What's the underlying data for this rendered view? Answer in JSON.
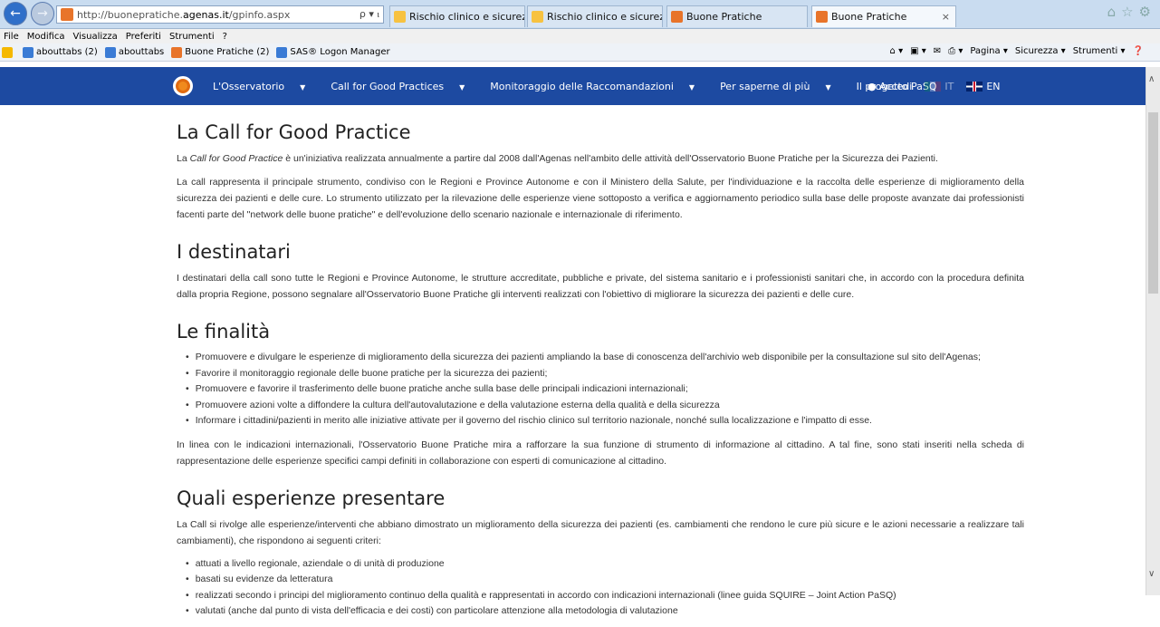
{
  "browser": {
    "address_url": "http://buonepratiche.agenas.it/gpinfo.aspx",
    "address_url_prefix": "http://buonepratiche.",
    "address_url_domain": "agenas.it",
    "address_url_suffix": "/gpinfo.aspx",
    "address_tools": "ρ ▾ ⲓ",
    "tabs": [
      {
        "label": "Rischio clinico e sicurezza del ..."
      },
      {
        "label": "Rischio clinico e sicurezza del ..."
      },
      {
        "label": "Buone Pratiche"
      },
      {
        "label": "Buone Pratiche"
      }
    ],
    "tab_close": "×",
    "menu": [
      "File",
      "Modifica",
      "Visualizza",
      "Preferiti",
      "Strumenti",
      "?"
    ],
    "favorites": [
      "abouttabs (2)",
      "abouttabs",
      "Buone Pratiche (2)",
      "SAS® Logon Manager"
    ],
    "command_bar": [
      "Pagina ▾",
      "Sicurezza ▾",
      "Strumenti ▾"
    ]
  },
  "site_nav": {
    "items": [
      {
        "label": "L'Osservatorio",
        "caret": true
      },
      {
        "label": "Call for Good Practices",
        "caret": true
      },
      {
        "label": "Monitoraggio delle Raccomandazioni",
        "caret": true
      },
      {
        "label": "Per saperne di più",
        "caret": true
      },
      {
        "label": "Il progetto PaSQ",
        "caret": false
      }
    ],
    "login": "Accedi",
    "lang_it": "IT",
    "lang_en": "EN"
  },
  "content": {
    "h1": "La Call for Good Practice",
    "p1_prefix": "La ",
    "p1_em": "Call for Good Practice",
    "p1_suffix": " è un'iniziativa realizzata annualmente a partire dal 2008 dall'Agenas nell'ambito delle attività dell'Osservatorio Buone Pratiche per la Sicurezza dei Pazienti.",
    "p2": "La call rappresenta il principale strumento, condiviso con le Regioni e Province Autonome e con il Ministero della Salute, per l'individuazione e la raccolta delle esperienze di miglioramento della sicurezza dei pazienti e delle cure. Lo strumento utilizzato per la rilevazione delle esperienze viene sottoposto a verifica e aggiornamento periodico sulla base delle proposte avanzate dai professionisti facenti parte del \"network delle buone pratiche\" e dell'evoluzione dello scenario nazionale e internazionale di riferimento.",
    "h2": "I destinatari",
    "p3": "I destinatari della call sono tutte le Regioni e Province Autonome, le strutture accreditate, pubbliche e private, del sistema sanitario e i professionisti sanitari che, in accordo con la procedura definita dalla propria Regione, possono segnalare all'Osservatorio Buone Pratiche gli interventi realizzati con l'obiettivo di migliorare la sicurezza dei pazienti e delle cure.",
    "h3": "Le finalità",
    "finalita": [
      "Promuovere e divulgare le esperienze di miglioramento della sicurezza dei pazienti ampliando la base di conoscenza dell'archivio web disponibile per la consultazione sul sito dell'Agenas;",
      "Favorire il monitoraggio regionale delle buone pratiche per la sicurezza dei pazienti;",
      "Promuovere e favorire il trasferimento delle buone pratiche anche sulla base delle principali indicazioni internazionali;",
      "Promuovere azioni volte a diffondere la cultura dell'autovalutazione e della valutazione esterna della qualità e della sicurezza",
      "Informare i cittadini/pazienti in merito alle iniziative attivate per il governo del rischio clinico sul territorio nazionale, nonché sulla localizzazione e l'impatto di esse."
    ],
    "p4": "In linea con le indicazioni internazionali, l'Osservatorio Buone Pratiche mira a rafforzare la sua funzione di strumento di informazione al cittadino. A tal fine, sono stati inseriti nella scheda di rappresentazione delle esperienze specifici campi definiti in collaborazione con esperti di comunicazione al cittadino.",
    "h4": "Quali esperienze presentare",
    "p5": "La Call si rivolge alle esperienze/interventi che abbiano dimostrato un miglioramento della sicurezza dei pazienti (es. cambiamenti che rendono le cure più sicure e le azioni necessarie a realizzare tali cambiamenti), che rispondono ai seguenti criteri:",
    "criteri": [
      "attuati a livello regionale, aziendale o di unità di produzione",
      "basati su evidenze da letteratura",
      "realizzati secondo i principi del miglioramento continuo della qualità e rappresentati in accordo con indicazioni internazionali (linee guida SQUIRE – Joint Action PaSQ)",
      "valutati (anche dal punto di vista dell'efficacia e dei costi) con particolare attenzione alla metodologia di valutazione"
    ]
  },
  "colors": {
    "nav_bg": "#1d4aa1",
    "logo_orange": "#f08a1d"
  },
  "icons": {
    "back": "back-arrow-icon",
    "forward": "forward-arrow-icon",
    "user": "user-icon",
    "scroll_up": "scroll-up-icon",
    "scroll_down": "scroll-down-icon"
  }
}
